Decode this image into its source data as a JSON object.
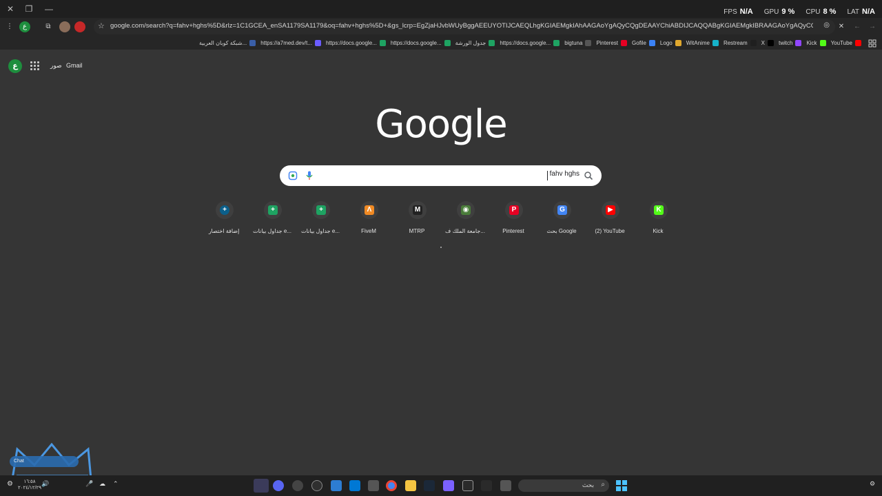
{
  "overlay": {
    "fps_label": "FPS",
    "fps_value": "N/A",
    "gpu_label": "GPU",
    "gpu_value": "9 %",
    "cpu_label": "CPU",
    "cpu_value": "8 %",
    "lat_label": "LAT",
    "lat_value": "N/A"
  },
  "toolbar": {
    "url": "google.com/search?q=fahv+hghs%5D&rlz=1C1GCEA_enSA1179SA1179&oq=fahv+hghs%5D+&gs_lcrp=EgZjaHJvbWUyBggAEEUYOTIJCAEQLhgKGIAEMgkIAhAAGAoYgAQyCQgDEAAYChiABDIJCAQQABgKGIAEMgkIBRAAGAoYgAQyCQgGEAAYChiABDIJCAcQABgKG..."
  },
  "bookmarks": [
    {
      "label": "YouTube",
      "color": "#ff0000"
    },
    {
      "label": "Kick",
      "color": "#53fc18"
    },
    {
      "label": "twitch",
      "color": "#9146ff"
    },
    {
      "label": "X",
      "color": "#000000"
    },
    {
      "label": "Restream",
      "color": "#1f1f1f"
    },
    {
      "label": "WitAnime",
      "color": "#16b2c9"
    },
    {
      "label": "Logo",
      "color": "#e0a82e"
    },
    {
      "label": "Gofile",
      "color": "#3b82f6"
    },
    {
      "label": "Pinterest",
      "color": "#e60023"
    },
    {
      "label": "bigtuna",
      "color": "#555555"
    },
    {
      "label": "https://docs.google...",
      "color": "#1ea362"
    },
    {
      "label": "جدول الورشة",
      "color": "#1ea362"
    },
    {
      "label": "https://docs.google...",
      "color": "#1ea362"
    },
    {
      "label": "https://docs.google...",
      "color": "#1ea362"
    },
    {
      "label": "https://a7med.dev/t...",
      "color": "#6b5cff"
    },
    {
      "label": "شبكة كوبان العربية...",
      "color": "#3a5fa8"
    }
  ],
  "header": {
    "avatar_letter": "ع",
    "images_link": "صور",
    "gmail_link": "Gmail"
  },
  "logo_text": "Google",
  "search": {
    "query": "fahv hghs"
  },
  "shortcuts": [
    {
      "label": "Kick",
      "icon": "K",
      "color": "#53fc18"
    },
    {
      "label": "(2) YouTube",
      "icon": "▶",
      "color": "#ff0000"
    },
    {
      "label": "بحث Google",
      "icon": "G",
      "color": "#4285f4"
    },
    {
      "label": "Pinterest",
      "icon": "P",
      "color": "#e60023"
    },
    {
      "label": "جامعة الملك ف...",
      "icon": "◉",
      "color": "#4a7c3a"
    },
    {
      "label": "MTRP",
      "icon": "M",
      "color": "#222222"
    },
    {
      "label": "FiveM",
      "icon": "Λ",
      "color": "#f08a24"
    },
    {
      "label": "جداول بيانات e...",
      "icon": "+",
      "color": "#1ea362"
    },
    {
      "label": "جداول بيانات e...",
      "icon": "+",
      "color": "#1ea362"
    },
    {
      "label": "إضافة اختصار",
      "icon": "+",
      "color": "#0b5f8a"
    }
  ],
  "taskbar": {
    "search_placeholder": "بحث",
    "time": "١٦:٥٨",
    "date": "٢٠٢٤/١٢/٢٩"
  },
  "watermark_chip": "Chat"
}
